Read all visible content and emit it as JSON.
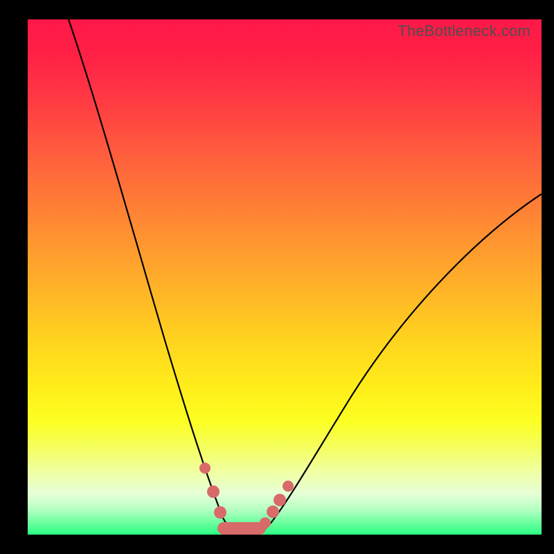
{
  "watermark": "TheBottleneck.com",
  "colors": {
    "background": "#000000",
    "curve": "#000000",
    "marker": "#d86a6a",
    "gradient_top": "#ff1848",
    "gradient_bottom": "#2bfd84"
  },
  "chart_data": {
    "type": "line",
    "title": "",
    "xlabel": "",
    "ylabel": "",
    "xlim": [
      0,
      100
    ],
    "ylim": [
      0,
      100
    ],
    "x": [
      8,
      12,
      16,
      20,
      24,
      28,
      30,
      32,
      34,
      36,
      38,
      40,
      42,
      44,
      46,
      48,
      52,
      56,
      60,
      66,
      74,
      82,
      90,
      100
    ],
    "y": [
      100,
      87,
      74,
      62,
      50,
      37,
      30,
      23,
      15,
      8,
      3,
      0,
      0,
      0,
      2,
      5,
      10,
      16,
      22,
      30,
      40,
      49,
      57,
      66
    ],
    "series": [
      {
        "name": "bottleneck-curve",
        "x": [
          8,
          12,
          16,
          20,
          24,
          28,
          30,
          32,
          34,
          36,
          38,
          40,
          42,
          44,
          46,
          48,
          52,
          56,
          60,
          66,
          74,
          82,
          90,
          100
        ],
        "y": [
          100,
          87,
          74,
          62,
          50,
          37,
          30,
          23,
          15,
          8,
          3,
          0,
          0,
          0,
          2,
          5,
          10,
          16,
          22,
          30,
          40,
          49,
          57,
          66
        ]
      }
    ],
    "markers": {
      "name": "highlighted-points",
      "x": [
        34.5,
        36.5,
        38,
        40,
        42,
        44,
        46,
        47.5,
        49,
        50.5
      ],
      "y": [
        13,
        8,
        3,
        0,
        0,
        0,
        2,
        4,
        6.5,
        9
      ]
    },
    "min_region": {
      "x_start": 38,
      "x_end": 46,
      "y": 0
    }
  }
}
